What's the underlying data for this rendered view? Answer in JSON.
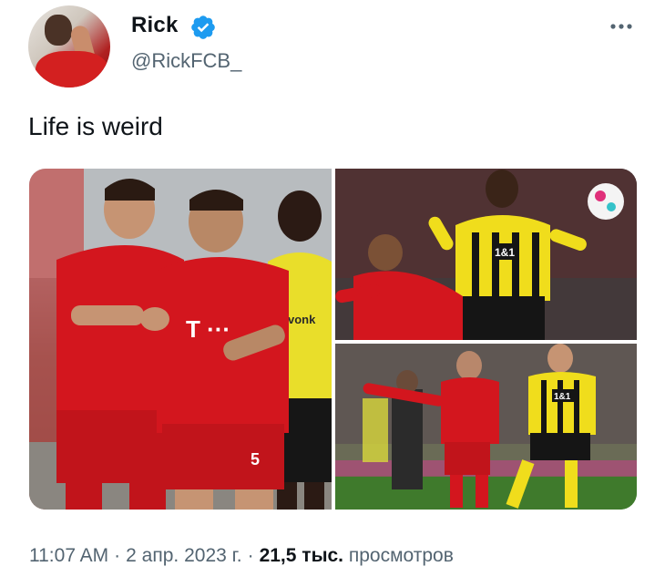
{
  "author": {
    "display_name": "Rick",
    "handle": "@RickFCB_",
    "verified": true
  },
  "tweet": {
    "text": "Life is weird",
    "time": "11:07 AM",
    "date": "2 апр. 2023 г.",
    "views_count": "21,5 тыс.",
    "views_label": "просмотров"
  },
  "photos": {
    "main": {
      "shirt_number": "5",
      "sponsor": "T ···",
      "opponent_sponsor": "vonk"
    },
    "top_right": {
      "yellow_shirt_sponsor": "1&1"
    },
    "bottom_right": {
      "yellow_shirt_sponsor": "1&1"
    }
  },
  "colors": {
    "verified_blue": "#1d9bf0",
    "text_primary": "#0f1419",
    "text_secondary": "#536471",
    "bayern_red": "#d3161e",
    "dortmund_yellow": "#f5e11c"
  },
  "icons": {
    "more": "more-horizontal-icon",
    "verified": "verified-badge-icon"
  }
}
